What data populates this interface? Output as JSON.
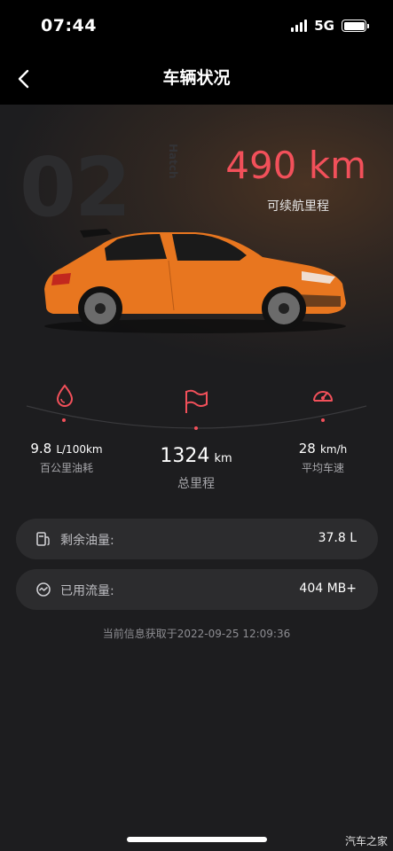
{
  "status": {
    "time": "07:44",
    "network": "5G"
  },
  "nav": {
    "title": "车辆状况"
  },
  "hero": {
    "watermark": "02",
    "watermark_small": "Hatch",
    "range_value": "490 km",
    "range_label": "可续航里程"
  },
  "stats": {
    "fuel": {
      "value": "9.8",
      "unit": "L/100km",
      "label": "百公里油耗"
    },
    "mileage": {
      "value": "1324",
      "unit": "km",
      "label": "总里程"
    },
    "speed": {
      "value": "28",
      "unit": "km/h",
      "label": "平均车速"
    }
  },
  "info": [
    {
      "label": "剩余油量:",
      "value": "37.8 L"
    },
    {
      "label": "已用流量:",
      "value": "404 MB+"
    }
  ],
  "timestamp": "当前信息获取于2022-09-25 12:09:36",
  "corner_watermark": "汽车之家",
  "colors": {
    "accent": "#f2505a",
    "background": "#1d1d1f",
    "card": "#2c2c2e",
    "car": "#e8761f"
  },
  "icons": {
    "fuel": "droplet-icon",
    "mileage": "flag-icon",
    "speed": "speedometer-icon",
    "fuel_level": "fuel-pump-icon",
    "data_usage": "data-usage-icon",
    "back": "chevron-left-icon"
  }
}
